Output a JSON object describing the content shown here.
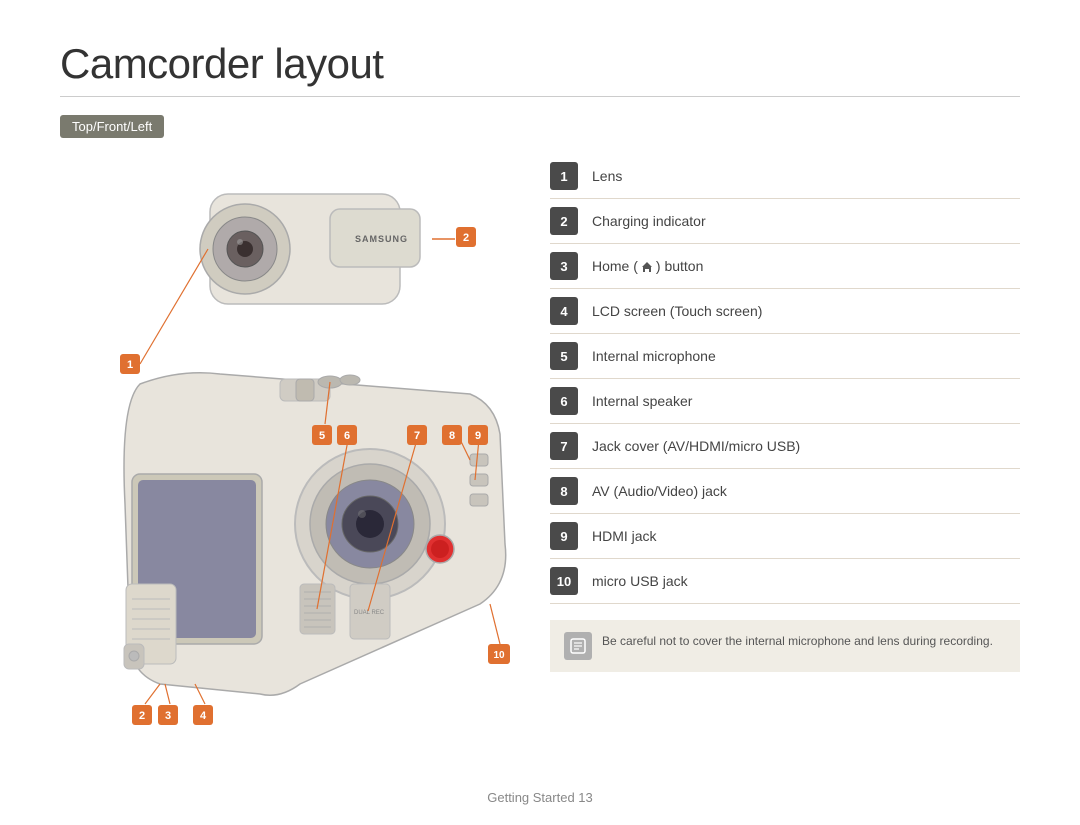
{
  "page": {
    "title": "Camcorder layout",
    "section_badge": "Top/Front/Left",
    "components": [
      {
        "number": "1",
        "label": "Lens"
      },
      {
        "number": "2",
        "label": "Charging indicator"
      },
      {
        "number": "3",
        "label": "Home (  ) button"
      },
      {
        "number": "4",
        "label": "LCD screen (Touch screen)"
      },
      {
        "number": "5",
        "label": "Internal microphone"
      },
      {
        "number": "6",
        "label": "Internal speaker"
      },
      {
        "number": "7",
        "label": "Jack cover (AV/HDMI/micro USB)"
      },
      {
        "number": "8",
        "label": "AV (Audio/Video) jack"
      },
      {
        "number": "9",
        "label": "HDMI jack"
      },
      {
        "number": "10",
        "label": "micro USB jack"
      }
    ],
    "note": "Be careful not to cover the internal microphone and lens during recording.",
    "footer": "Getting Started   13"
  }
}
